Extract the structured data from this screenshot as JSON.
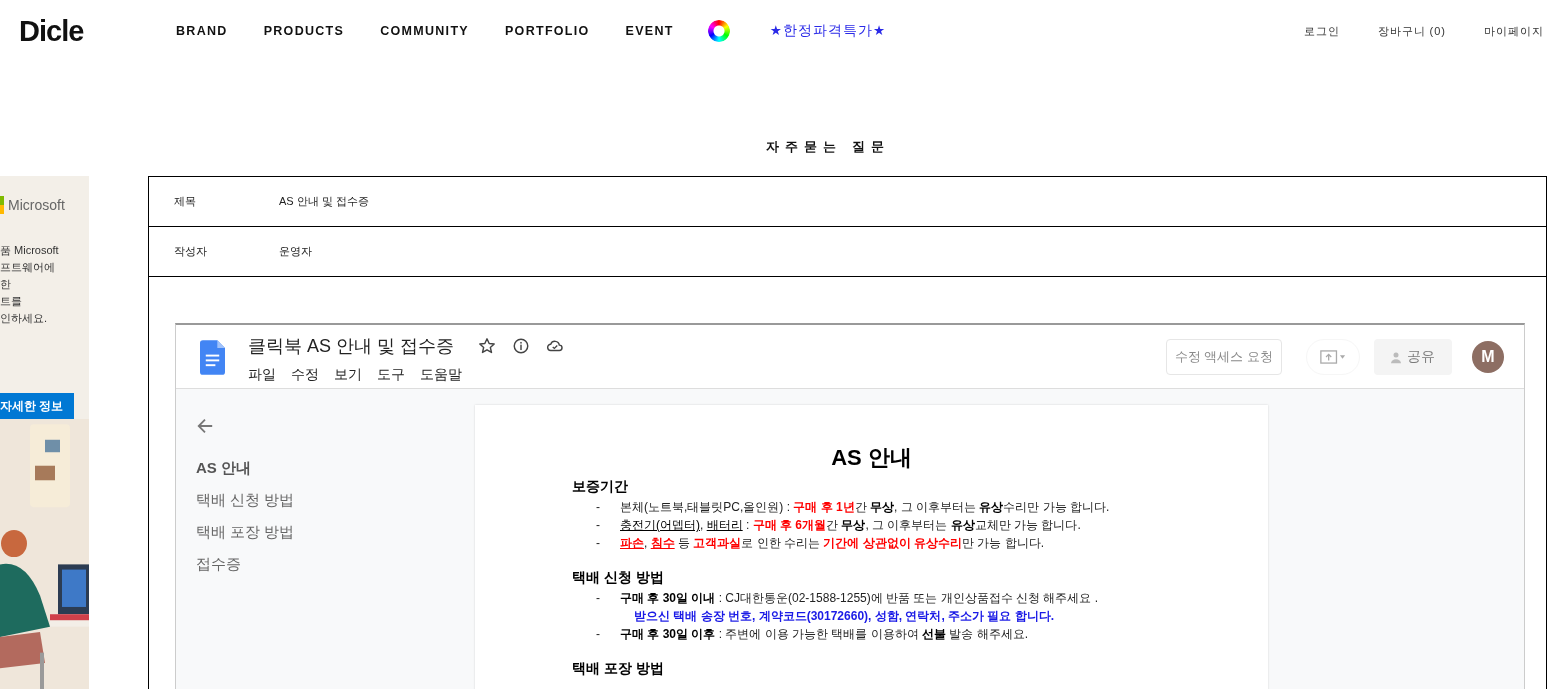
{
  "header": {
    "logo": "Dicle",
    "nav": [
      {
        "label": "BRAND"
      },
      {
        "label": "PRODUCTS"
      },
      {
        "label": "COMMUNITY"
      },
      {
        "label": "PORTFOLIO"
      },
      {
        "label": "EVENT"
      }
    ],
    "promo": "★한정파격특가★",
    "user_links": [
      "로그인",
      "장바구니 (0)",
      "마이페이지"
    ]
  },
  "ad": {
    "brand": "Microsoft",
    "lines": [
      "품 Microsoft",
      "프트웨어에",
      "한",
      "트를",
      "인하세요."
    ],
    "button": "자세한 정보"
  },
  "page_title": "자주묻는 질문",
  "post": {
    "fields": [
      {
        "label": "제목",
        "value": "AS 안내 및 접수증"
      },
      {
        "label": "작성자",
        "value": "운영자"
      }
    ]
  },
  "doc": {
    "title": "클릭북 AS 안내 및 접수증",
    "menus": [
      "파일",
      "수정",
      "보기",
      "도구",
      "도움말"
    ],
    "request_button": "수정 액세스 요청",
    "share_button": "공유",
    "avatar": "M",
    "outline": [
      {
        "label": "AS 안내",
        "selected": true
      },
      {
        "label": "택배 신청 방법",
        "selected": false
      },
      {
        "label": "택배 포장 방법",
        "selected": false
      },
      {
        "label": "접수증",
        "selected": false
      }
    ],
    "heading": "AS 안내",
    "sections": [
      {
        "title": "보증기간",
        "items": [
          {
            "kind": "bullet",
            "marker": "-",
            "segments": [
              {
                "kind": "plain",
                "t": "본체(노트북,태블릿PC,올인원) : "
              },
              {
                "kind": "red",
                "t": "구매 후 1년"
              },
              {
                "kind": "plain",
                "t": "간 "
              },
              {
                "kind": "bold",
                "t": "무상"
              },
              {
                "kind": "plain",
                "t": ", 그 이후부터는 "
              },
              {
                "kind": "bold",
                "t": "유상"
              },
              {
                "kind": "plain",
                "t": "수리만 가능 합니다."
              }
            ]
          },
          {
            "kind": "bullet",
            "marker": "-",
            "segments": [
              {
                "kind": "underline",
                "t": "충전기(어뎁터)"
              },
              {
                "kind": "plain",
                "t": ", "
              },
              {
                "kind": "underline",
                "t": "배터리"
              },
              {
                "kind": "plain",
                "t": " : "
              },
              {
                "kind": "red",
                "t": "구매 후 6개월"
              },
              {
                "kind": "plain",
                "t": "간 "
              },
              {
                "kind": "bold",
                "t": "무상"
              },
              {
                "kind": "plain",
                "t": ", 그 이후부터는 "
              },
              {
                "kind": "bold",
                "t": "유상"
              },
              {
                "kind": "plain",
                "t": "교체만 가능 합니다."
              }
            ]
          },
          {
            "kind": "bullet",
            "marker": "-",
            "segments": [
              {
                "kind": "redline",
                "t": "파손"
              },
              {
                "kind": "plain",
                "t": ", "
              },
              {
                "kind": "redline",
                "t": "침수"
              },
              {
                "kind": "plain",
                "t": " 등 "
              },
              {
                "kind": "red",
                "t": "고객과실"
              },
              {
                "kind": "plain",
                "t": "로 인한 수리는 "
              },
              {
                "kind": "red",
                "t": "기간에 상관없이 유상수리"
              },
              {
                "kind": "plain",
                "t": "만 가능 합니다."
              }
            ]
          }
        ]
      },
      {
        "title": "택배 신청 방법",
        "items": [
          {
            "kind": "bullet",
            "marker": "-",
            "segments": [
              {
                "kind": "bold",
                "t": "구매 후 30일 이내"
              },
              {
                "kind": "plain",
                "t": " : CJ대한통운(02-1588-1255)에 반품 또는 개인상품접수 신청 해주세요 ."
              }
            ]
          },
          {
            "kind": "continuation",
            "segments": [
              {
                "kind": "blue",
                "t": "받으신 택배 송장 번호, 계약코드(30172660), 성함, 연락처, 주소가 필요 합니다."
              }
            ]
          },
          {
            "kind": "bullet",
            "marker": "-",
            "segments": [
              {
                "kind": "bold",
                "t": "구매 후 30일 이후"
              },
              {
                "kind": "plain",
                "t": " : 주변에 이용 가능한 택배를 이용하여 "
              },
              {
                "kind": "bold",
                "t": "선불"
              },
              {
                "kind": "plain",
                "t": " 발송 해주세요."
              }
            ]
          }
        ]
      },
      {
        "title": "택배 포장 방법"
      }
    ]
  }
}
